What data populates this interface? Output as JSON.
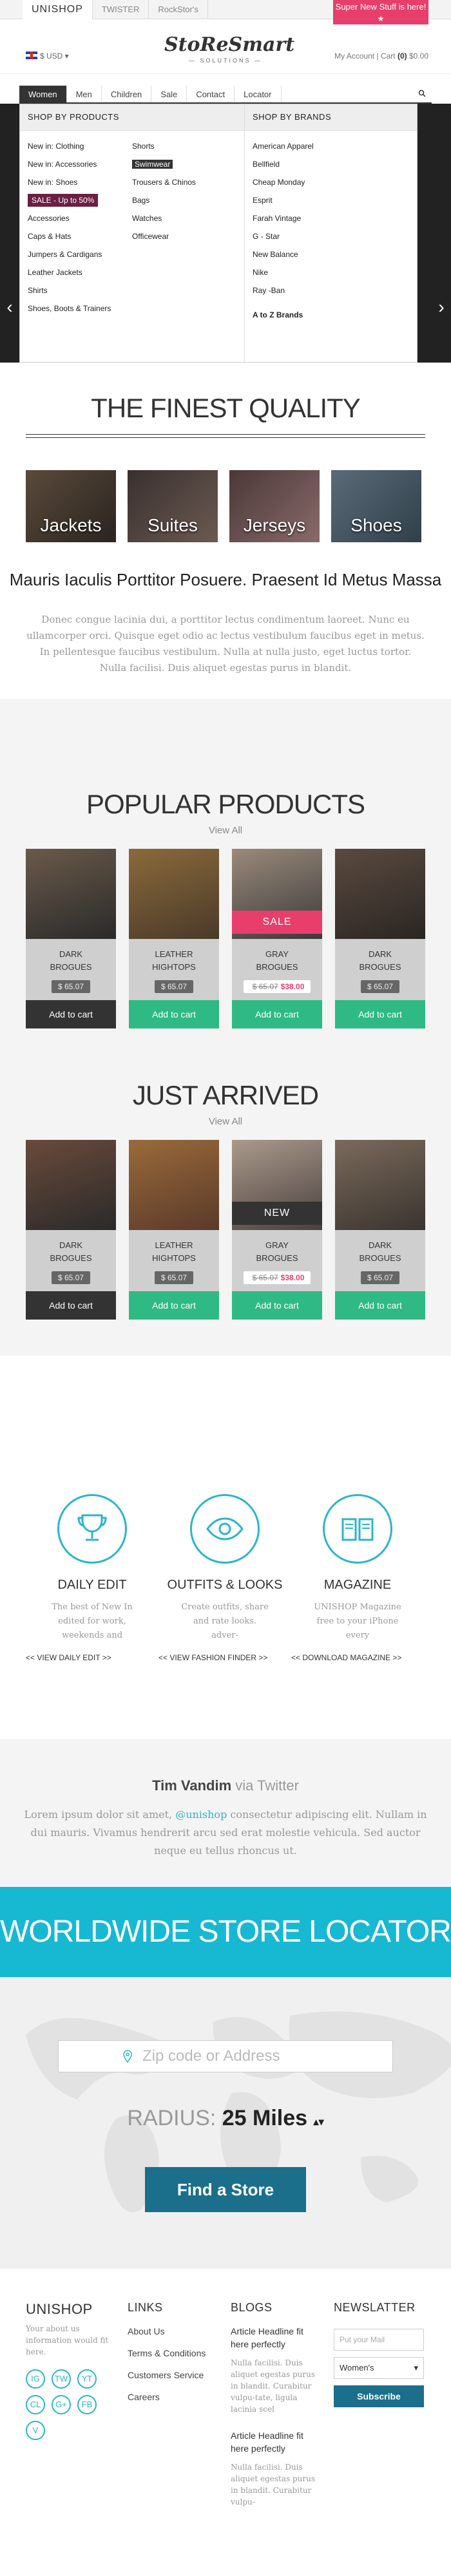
{
  "topbar": {
    "tabs": [
      "UNISHOP",
      "TWISTER",
      "RockStor's"
    ],
    "promo": "Super New Stuff is here!",
    "promo_star": "★"
  },
  "header": {
    "currency": "$ USD ▾",
    "logo": "StoReSmart",
    "logo_sub": "— SOLUTIONS —",
    "account": "My Account",
    "cart_label": "Cart",
    "cart_count": "(0)",
    "cart_total": "$0.00"
  },
  "nav": {
    "items": [
      "Women",
      "Men",
      "Children",
      "Sale",
      "Contact",
      "Locator"
    ],
    "search_icon": "search-icon"
  },
  "mega": {
    "products_head": "SHOP BY PRODUCTS",
    "col1": [
      "New in: Clothing",
      "New in: Accessories",
      "New in: Shoes"
    ],
    "sale_tag": "SALE - Up to 50%",
    "col1b": [
      "Accessories",
      "Caps & Hats",
      "Jumpers & Cardigans",
      "Leather Jackets",
      "Shirts",
      "Shoes, Boots & Trainers"
    ],
    "col2": [
      "Shorts",
      "Swimwear",
      "Trousers & Chinos",
      "Bags",
      "Watches",
      "Officewear"
    ],
    "brands_head": "SHOP BY BRANDS",
    "brands": [
      "American Apparel",
      "Bellfield",
      "Cheap Monday",
      "Esprit",
      "Farah Vintage",
      "G - Star",
      "New Balance",
      "Nike",
      "Ray -Ban"
    ],
    "atoz": "A to Z  Brands"
  },
  "quality": {
    "title": "THE FINEST QUALITY",
    "categories": [
      "Jackets",
      "Suites",
      "Jerseys",
      "Shoes"
    ],
    "tagline": "Mauris Iaculis Porttitor Posuere. Praesent Id Metus Massa",
    "text": "Donec congue lacinia dui, a porttitor lectus condimentum laoreet. Nunc eu ullamcorper orci. Quisque eget odio ac lectus vestibulum faucibus eget in metus. In pellentesque faucibus vestibulum. Nulla at nulla justo, eget luctus tortor. Nulla facilisi. Duis aliquet egestas purus in blandit."
  },
  "popular": {
    "title": "POPULAR PRODUCTS",
    "view_all": "View All",
    "products": [
      {
        "name1": "DARK",
        "name2": "BROGUES",
        "price": "$ 65.07",
        "btn": "Add to cart"
      },
      {
        "name1": "LEATHER",
        "name2": "HIGHTOPS",
        "price": "$ 65.07",
        "btn": "Add to cart"
      },
      {
        "name1": "GRAY",
        "name2": "BROGUES",
        "old": "$ 65.07",
        "new": "$38.00",
        "btn": "Add to cart",
        "badge": "SALE"
      },
      {
        "name1": "DARK",
        "name2": "BROGUES",
        "price": "$ 65.07",
        "btn": "Add to cart"
      }
    ]
  },
  "arrived": {
    "title": "JUST ARRIVED",
    "view_all": "View All",
    "products": [
      {
        "name1": "DARK",
        "name2": "BROGUES",
        "price": "$ 65.07",
        "btn": "Add to cart"
      },
      {
        "name1": "LEATHER",
        "name2": "HIGHTOPS",
        "price": "$ 65.07",
        "btn": "Add to cart"
      },
      {
        "name1": "GRAY",
        "name2": "BROGUES",
        "old": "$ 65.07",
        "new": "$38.00",
        "btn": "Add to cart",
        "badge": "NEW"
      },
      {
        "name1": "DARK",
        "name2": "BROGUES",
        "price": "$ 65.07",
        "btn": "Add to cart"
      }
    ]
  },
  "features": [
    {
      "title": "DAILY EDIT",
      "desc": "The best of New In edited for work, weekends and",
      "link": "<< VIEW DAILY EDIT >>",
      "icon": "trophy-icon"
    },
    {
      "title": "OUTFITS & LOOKS",
      "desc": "Create outfits, share and rate looks. adver-",
      "link": "<< VIEW FASHION FINDER >>",
      "icon": "eye-icon"
    },
    {
      "title": "MAGAZINE",
      "desc": "UNISHOP Magazine free to your iPhone every",
      "link": "<< DOWNLOAD MAGAZINE >>",
      "icon": "book-icon"
    }
  ],
  "twitter": {
    "name": "Tim Vandim",
    "via": "via Twitter",
    "pre": "Lorem ipsum dolor sit amet, ",
    "handle": "@unishop",
    "post": " consectetur adipiscing elit. Nullam in dui mauris. Vivamus hendrerit arcu sed erat molestie vehicula. Sed auctor neque eu tellus rhoncus ut."
  },
  "locator": {
    "title": "WORLDWIDE STORE LOCATOR",
    "placeholder": "Zip code or Address",
    "radius_label": "RADIUS:",
    "radius_value": "25 Miles",
    "radius_arrows": "▴▾",
    "button": "Find a Store"
  },
  "footer": {
    "brand": "UNISHOP",
    "about": "Your about us information would fit here.",
    "social": [
      "IG",
      "TW",
      "YT",
      "CL",
      "G+",
      "FB",
      "V"
    ],
    "links_head": "LINKS",
    "links": [
      "About Us",
      "Terms & Conditions",
      "Customers Service",
      "Careers"
    ],
    "blogs_head": "BLOGS",
    "blogs": [
      {
        "title": "Article Headline fit here perfectly",
        "desc": "Nulla facilisi. Duis aliquet egestas purus in blandit. Curabitur vulpu-tate, ligula lacinia scel"
      },
      {
        "title": "Article Headline fit here perfectly",
        "desc": "Nulla facilisi. Duis aliquet egestas purus in blandit. Curabitur vulpu-"
      }
    ],
    "news_head": "NEWSLATTER",
    "news_placeholder": "Put your Mail",
    "news_select": "Women's",
    "news_btn": "Subscribe"
  },
  "colors": {
    "accent": "#2ab6c8",
    "pink": "#e83e6c",
    "green": "#2fb985",
    "dark": "#333333",
    "teal": "#17b8d2"
  }
}
